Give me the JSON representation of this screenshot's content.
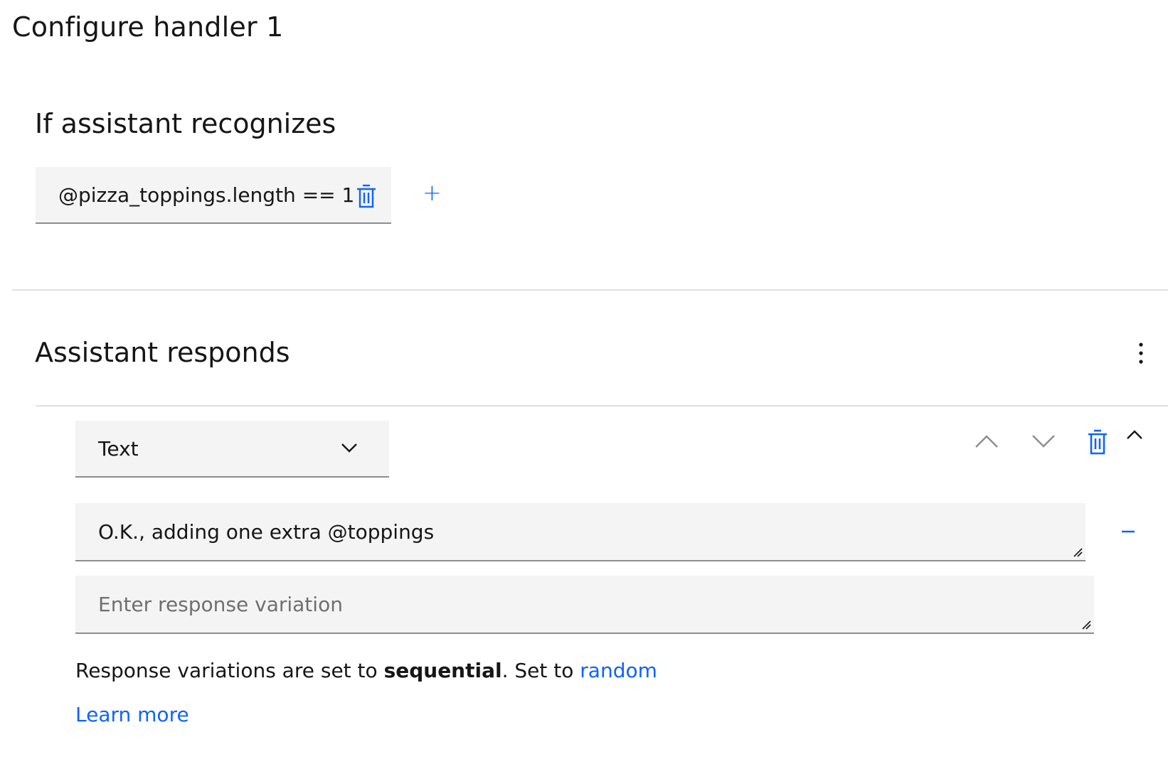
{
  "page": {
    "title": "Configure handler 1"
  },
  "condition_section": {
    "heading": "If assistant recognizes",
    "condition_text": "@pizza_toppings.length == 1",
    "add_symbol": "+"
  },
  "response_section": {
    "heading": "Assistant responds",
    "response_type": {
      "selected": "Text"
    },
    "variations": [
      {
        "value": "O.K., adding one extra @toppings"
      }
    ],
    "new_variation_placeholder": "Enter response variation",
    "note": {
      "prefix": "Response variations are set to ",
      "mode": "sequential",
      "middle": ". Set to ",
      "link": "random"
    },
    "learn_more": "Learn more"
  },
  "icons": {
    "delete": "trash-icon",
    "add": "plus-icon",
    "overflow": "overflow-menu-vertical-icon",
    "dropdown": "chevron-down-icon",
    "move_up": "chevron-up-icon",
    "move_down": "chevron-down-icon",
    "collapse": "chevron-up-icon",
    "remove": "minus-icon"
  },
  "colors": {
    "accent": "#0f62fe",
    "field_bg": "#f4f4f4",
    "text": "#161616",
    "placeholder": "#6f6f6f",
    "divider": "#e0e0e0"
  }
}
